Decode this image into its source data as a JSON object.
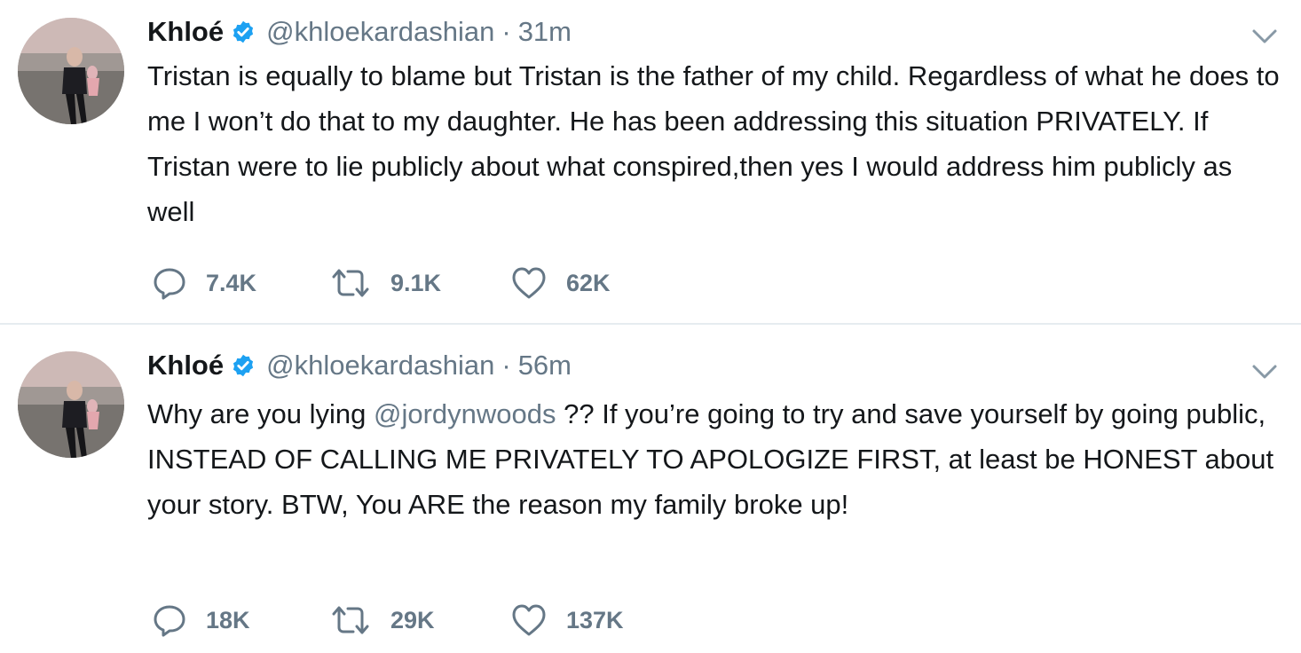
{
  "tweets": [
    {
      "name": "Khloé",
      "handle": "@khloekardashian",
      "separator": "·",
      "time": "31m",
      "text_parts": [
        "Tristan is equally to blame but Tristan is the father of my child. Regardless of what he does to me I won’t do that to my daughter. He has been addressing this situation PRIVATELY. If Tristan were to lie publicly about what conspired,then yes I would address him publicly as well"
      ],
      "replies": "7.4K",
      "retweets": "9.1K",
      "likes": "62K"
    },
    {
      "name": "Khloé",
      "handle": "@khloekardashian",
      "separator": "·",
      "time": "56m",
      "text_before_mention": "Why are you lying ",
      "mention": "@jordynwoods",
      "text_after_mention": " ?? If you’re going to try and save yourself by going public, INSTEAD OF CALLING ME PRIVATELY TO APOLOGIZE FIRST, at least be HONEST about your story. BTW, You ARE the reason my family broke up!",
      "replies": "18K",
      "retweets": "29K",
      "likes": "137K"
    }
  ],
  "icons": {
    "verified": "verified-badge-icon",
    "caret": "chevron-down-icon",
    "reply": "reply-bubble-icon",
    "retweet": "retweet-icon",
    "like": "heart-icon",
    "avatar": "profile-photo-beach"
  },
  "colors": {
    "text": "#14171a",
    "muted": "#657786",
    "verified": "#1da1f2",
    "divider": "#e6ecf0"
  }
}
